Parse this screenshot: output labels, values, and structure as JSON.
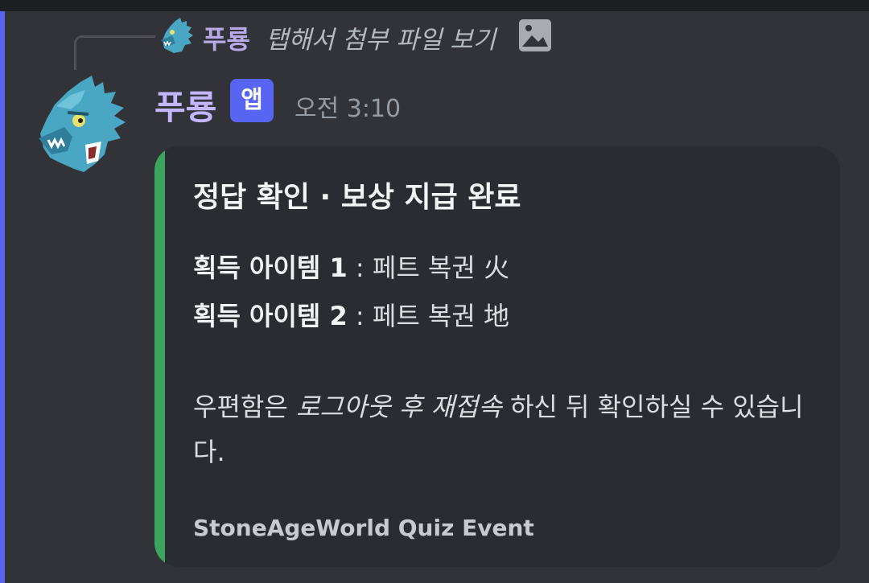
{
  "reply": {
    "author": "푸룡",
    "text": "탭해서 첨부 파일 보기",
    "attachment_icon": "image-icon"
  },
  "message": {
    "author": "푸룡",
    "badge": "앱",
    "timestamp": "오전 3:10"
  },
  "embed": {
    "accent_color": "#3aa55d",
    "title": "정답 확인 · 보상 지급 완료",
    "fields": [
      {
        "label": "획득 아이템 1",
        "separator": " : ",
        "value": "페트 복권 火"
      },
      {
        "label": "획득 아이템 2",
        "separator": " : ",
        "value": "페트 복권 地"
      }
    ],
    "description": {
      "part1": "우편함은 ",
      "emphasis": "로그아웃 후 재접속",
      "part2": " 하신 뒤 확인하실 수 있습니다."
    },
    "footer": "StoneAgeWorld Quiz Event"
  },
  "colors": {
    "background": "#323339",
    "embed_background": "#2b2c31",
    "brand": "#5865f2",
    "username": "#c4b5ff"
  }
}
